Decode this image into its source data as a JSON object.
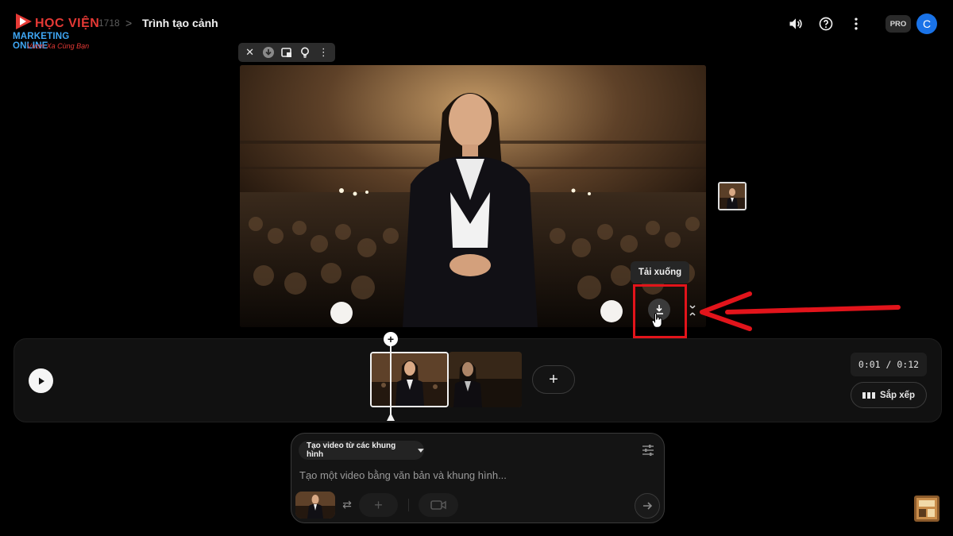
{
  "app": {
    "logo_line1": "HỌC VIỆN",
    "logo_line2": "MARKETING ONLINE",
    "logo_line3": "Vươn Xa Cùng Bạn"
  },
  "header": {
    "breadcrumb_id": "1718",
    "breadcrumb_separator": ">",
    "title": "Trình tạo cảnh",
    "icons": [
      "volume-icon",
      "help-icon",
      "more-vert-icon"
    ],
    "plan_badge": "PRO",
    "avatar_initial": "C"
  },
  "frame_toolbar": {
    "buttons": [
      "close-icon",
      "download-icon",
      "copy-frame-icon",
      "idea-icon",
      "more-vert-icon"
    ]
  },
  "preview": {
    "tooltip": "Tải xuống",
    "download_icon": "download-icon",
    "expand_icon": "expand-icon"
  },
  "timeline": {
    "time": "0:01 / 0:12",
    "arrange_label": "Sắp xếp",
    "add_clip_label": "+",
    "playhead_add": "+"
  },
  "prompt": {
    "mode": "Tạo video từ các khung hình",
    "placeholder": "Tạo một video bằng văn bản và khung hình...",
    "slot_label": "+"
  },
  "colors": {
    "highlight": "#e2141b",
    "accent_avatar": "#1a73e8",
    "logo_red": "#e53935",
    "logo_blue": "#3fa7f5"
  }
}
